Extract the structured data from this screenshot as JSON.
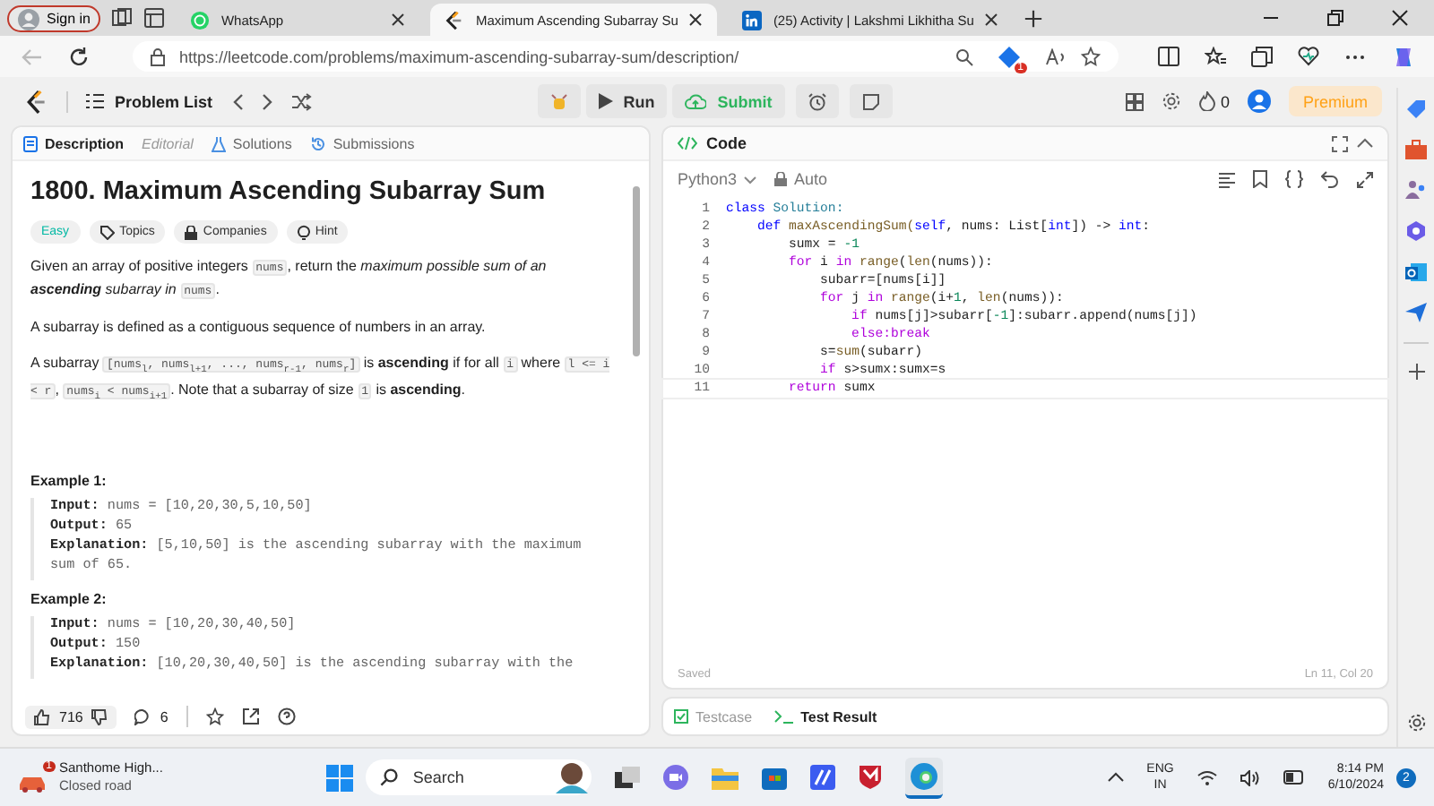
{
  "browser": {
    "profile": "Sign in",
    "tabs": [
      {
        "title": "WhatsApp",
        "kind": "whatsapp",
        "selected": false
      },
      {
        "title": "Maximum Ascending Subarray Su",
        "kind": "leetcode",
        "selected": true
      },
      {
        "title": "(25) Activity | Lakshmi Likhitha Su",
        "kind": "linkedin",
        "selected": false
      }
    ],
    "url": "https://leetcode.com/problems/maximum-ascending-subarray-sum/description/",
    "ext_badge": "1"
  },
  "header": {
    "problem_list": "Problem List",
    "run": "Run",
    "submit": "Submit",
    "streak": "0",
    "premium": "Premium"
  },
  "description": {
    "tabs": [
      {
        "label": "Description",
        "selected": true,
        "disabled": false
      },
      {
        "label": "Editorial",
        "selected": false,
        "disabled": true
      },
      {
        "label": "Solutions",
        "selected": false,
        "disabled": false
      },
      {
        "label": "Submissions",
        "selected": false,
        "disabled": false
      }
    ],
    "title": "1800. Maximum Ascending Subarray Sum",
    "difficulty": "Easy",
    "chips": [
      "Topics",
      "Companies",
      "Hint"
    ],
    "paragraphs": [
      [
        {
          "kind": "text",
          "t": "Given an array of positive integers "
        },
        {
          "kind": "code",
          "t": "nums"
        },
        {
          "kind": "text",
          "t": ", return the "
        },
        {
          "kind": "em",
          "t": "maximum possible sum of an **ascending** subarray in "
        },
        {
          "kind": "code",
          "t": "nums"
        },
        {
          "kind": "text",
          "t": "."
        }
      ],
      [
        {
          "kind": "text",
          "t": "A subarray is defined as a contiguous sequence of numbers in an array."
        }
      ],
      [
        {
          "kind": "text",
          "t": "A subarray "
        },
        {
          "kind": "code",
          "t": "[nums$_{l}$, nums$_{l+1}$, ..., nums$_{r-1}$, nums$_{r}$]"
        },
        {
          "kind": "text",
          "t": " is **ascending** if for all "
        },
        {
          "kind": "code",
          "t": "i"
        },
        {
          "kind": "text",
          "t": " where "
        },
        {
          "kind": "code",
          "t": "l <= i < r"
        },
        {
          "kind": "text",
          "t": ", "
        },
        {
          "kind": "code",
          "t": "nums$_{i}$ < nums$_{i+1}$"
        },
        {
          "kind": "text",
          "t": ". Note that a subarray of size "
        },
        {
          "kind": "code",
          "t": "1"
        },
        {
          "kind": "text",
          "t": " is **ascending**."
        }
      ]
    ],
    "examples": [
      {
        "title": "Example 1:",
        "lines": [
          {
            "label": "Input:",
            "value": "nums = [10,20,30,5,10,50]"
          },
          {
            "label": "Output:",
            "value": "65"
          },
          {
            "label": "Explanation:",
            "value": "[5,10,50] is the ascending subarray with the maximum sum of 65."
          }
        ]
      },
      {
        "title": "Example 2:",
        "lines": [
          {
            "label": "Input:",
            "value": "nums = [10,20,30,40,50]"
          },
          {
            "label": "Output:",
            "value": "150"
          },
          {
            "label": "Explanation:",
            "value": "[10,20,30,40,50] is the ascending subarray with the"
          }
        ]
      }
    ],
    "likes": "716",
    "comments": "6"
  },
  "code": {
    "title": "Code",
    "language": "Python3",
    "mode": "Auto",
    "lines": [
      {
        "n": "1",
        "segs": [
          {
            "kind": "kw",
            "t": "class"
          },
          {
            "kind": "id",
            "t": " Solution:"
          }
        ]
      },
      {
        "n": "2",
        "segs": [
          {
            "kind": "kw",
            "t": "    def"
          },
          {
            "kind": "fn",
            "t": " maxAscendingSum("
          },
          {
            "kind": "kw",
            "t": "self"
          },
          {
            "kind": "pl",
            "t": ", nums: List["
          },
          {
            "kind": "kw",
            "t": "int"
          },
          {
            "kind": "pl",
            "t": "]) -> "
          },
          {
            "kind": "kw",
            "t": "int"
          },
          {
            "kind": "pl",
            "t": ":"
          }
        ]
      },
      {
        "n": "3",
        "segs": [
          {
            "kind": "pl",
            "t": "        sumx = "
          },
          {
            "kind": "num",
            "t": "-1"
          }
        ]
      },
      {
        "n": "4",
        "segs": [
          {
            "kind": "ctl",
            "t": "        for"
          },
          {
            "kind": "pl",
            "t": " i "
          },
          {
            "kind": "ctl",
            "t": "in"
          },
          {
            "kind": "fn",
            "t": " range"
          },
          {
            "kind": "pl",
            "t": "("
          },
          {
            "kind": "fn",
            "t": "len"
          },
          {
            "kind": "pl",
            "t": "(nums)):"
          }
        ]
      },
      {
        "n": "5",
        "segs": [
          {
            "kind": "pl",
            "t": "            subarr=[nums[i]]"
          }
        ]
      },
      {
        "n": "6",
        "segs": [
          {
            "kind": "ctl",
            "t": "            for"
          },
          {
            "kind": "pl",
            "t": " j "
          },
          {
            "kind": "ctl",
            "t": "in"
          },
          {
            "kind": "fn",
            "t": " range"
          },
          {
            "kind": "pl",
            "t": "(i+"
          },
          {
            "kind": "num",
            "t": "1"
          },
          {
            "kind": "pl",
            "t": ", "
          },
          {
            "kind": "fn",
            "t": "len"
          },
          {
            "kind": "pl",
            "t": "(nums)):"
          }
        ]
      },
      {
        "n": "7",
        "segs": [
          {
            "kind": "ctl",
            "t": "                if"
          },
          {
            "kind": "pl",
            "t": " nums[j]>subarr["
          },
          {
            "kind": "num",
            "t": "-1"
          },
          {
            "kind": "pl",
            "t": "]:subarr.append(nums[j])"
          }
        ]
      },
      {
        "n": "8",
        "segs": [
          {
            "kind": "ctl",
            "t": "                else:break"
          }
        ]
      },
      {
        "n": "9",
        "segs": [
          {
            "kind": "pl",
            "t": "            s="
          },
          {
            "kind": "fn",
            "t": "sum"
          },
          {
            "kind": "pl",
            "t": "(subarr)"
          }
        ]
      },
      {
        "n": "10",
        "segs": [
          {
            "kind": "ctl",
            "t": "            if"
          },
          {
            "kind": "pl",
            "t": " s>sumx:sumx=s"
          }
        ]
      },
      {
        "n": "11",
        "segs": [
          {
            "kind": "ctl",
            "t": "        return"
          },
          {
            "kind": "pl",
            "t": " sumx"
          }
        ]
      }
    ],
    "status": "Saved",
    "cursor": "Ln 11, Col 20",
    "bottom_tabs": [
      {
        "label": "Testcase",
        "selected": false
      },
      {
        "label": "Test Result",
        "selected": true
      }
    ]
  },
  "taskbar": {
    "news_title": "Santhome High...",
    "news_subtitle": "Closed road",
    "news_badge": "1",
    "search": "Search",
    "lang": "ENG",
    "region": "IN",
    "time": "8:14 PM",
    "date": "6/10/2024",
    "notifications": "2"
  }
}
